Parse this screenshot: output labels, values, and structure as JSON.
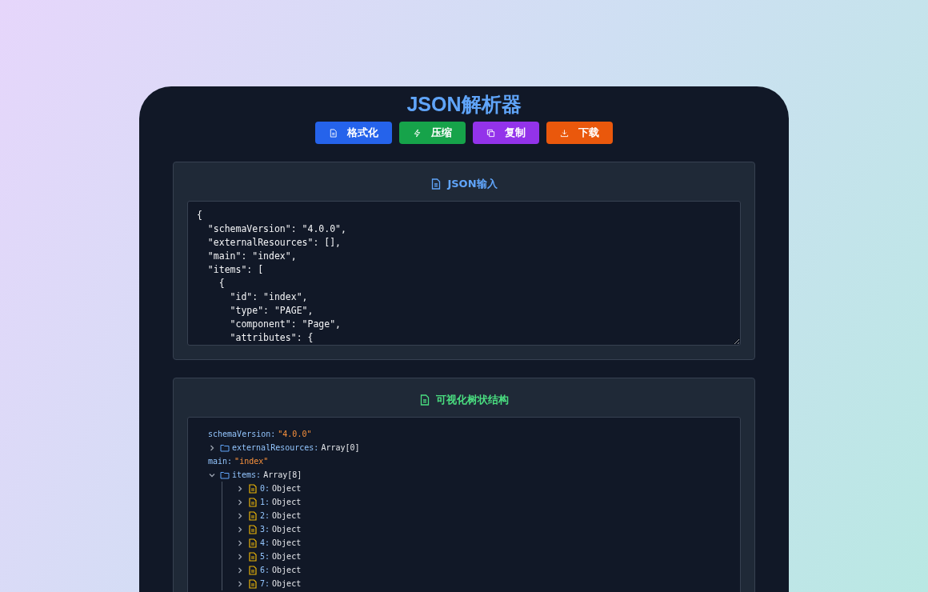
{
  "title": "JSON解析器",
  "buttons": [
    {
      "label": "格式化",
      "kind": "format",
      "color": "#2563eb"
    },
    {
      "label": "压缩",
      "kind": "compress",
      "color": "#16a34a"
    },
    {
      "label": "复制",
      "kind": "copy",
      "color": "#9333ea"
    },
    {
      "label": "下载",
      "kind": "download",
      "color": "#ea580c"
    }
  ],
  "input_panel": {
    "title": "JSON输入",
    "value": "{\n  \"schemaVersion\": \"4.0.0\",\n  \"externalResources\": [],\n  \"main\": \"index\",\n  \"items\": [\n    {\n      \"id\": \"index\",\n      \"type\": \"PAGE\",\n      \"component\": \"Page\",\n      \"attributes\": {"
  },
  "tree_panel": {
    "title": "可视化树状结构",
    "nodes": [
      {
        "kind": "value",
        "key": "schemaVersion:",
        "value": "\"4.0.0\""
      },
      {
        "kind": "array",
        "key": "externalResources:",
        "value": "Array[0]",
        "expanded": false
      },
      {
        "kind": "value",
        "key": "main:",
        "value": "\"index\""
      },
      {
        "kind": "array",
        "key": "items:",
        "value": "Array[8]",
        "expanded": true,
        "children": [
          {
            "kind": "object",
            "key": "0:",
            "value": "Object",
            "expanded": false
          },
          {
            "kind": "object",
            "key": "1:",
            "value": "Object",
            "expanded": false
          },
          {
            "kind": "object",
            "key": "2:",
            "value": "Object",
            "expanded": false
          },
          {
            "kind": "object",
            "key": "3:",
            "value": "Object",
            "expanded": false
          },
          {
            "kind": "object",
            "key": "4:",
            "value": "Object",
            "expanded": false
          },
          {
            "kind": "object",
            "key": "5:",
            "value": "Object",
            "expanded": false
          },
          {
            "kind": "object",
            "key": "6:",
            "value": "Object",
            "expanded": false
          },
          {
            "kind": "object",
            "key": "7:",
            "value": "Object",
            "expanded": false
          }
        ]
      }
    ]
  }
}
